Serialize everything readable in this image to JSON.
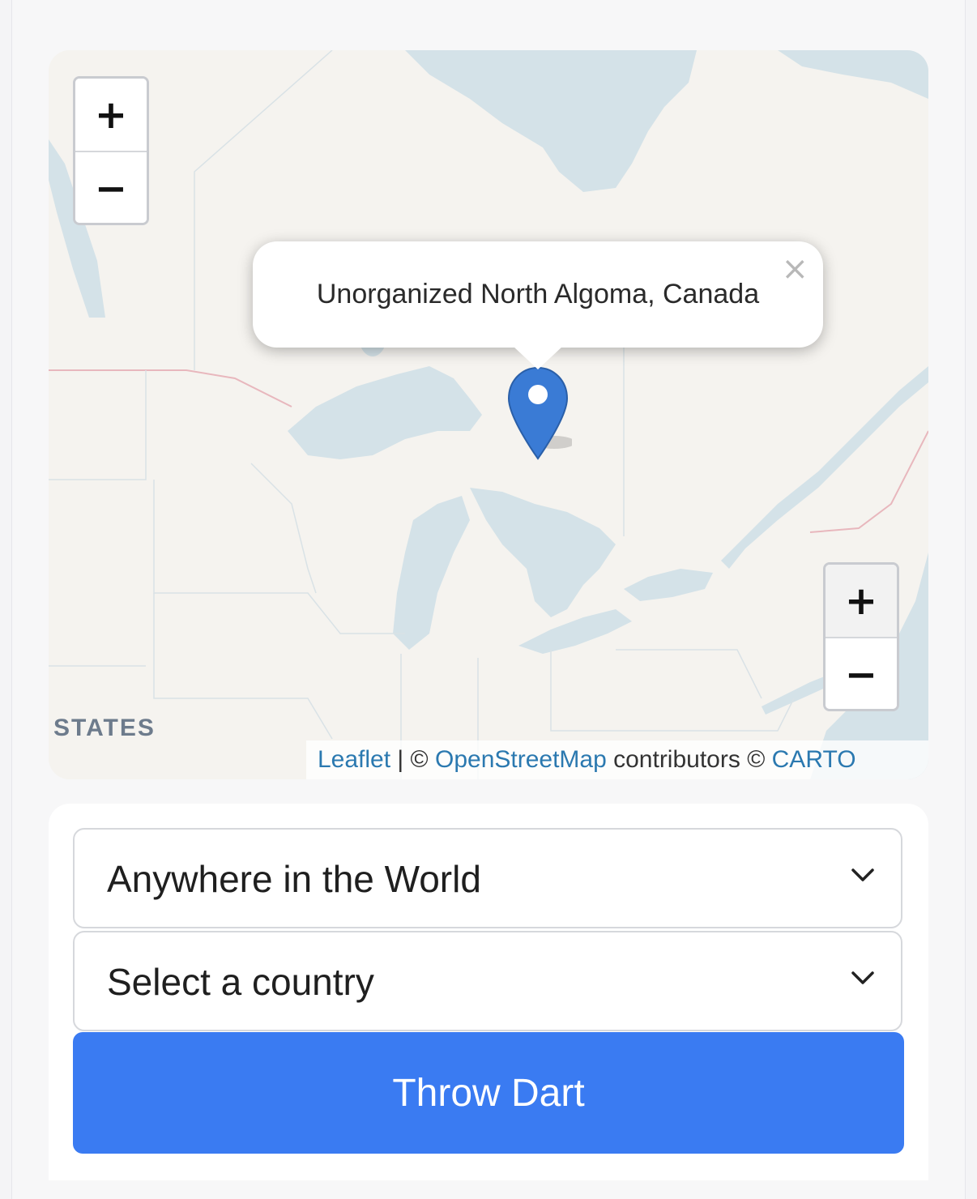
{
  "map": {
    "popup_text": "Unorganized North Algoma, Canada",
    "popup_close": "×",
    "zoom_in": "+",
    "zoom_out": "−",
    "region_label": "STATES",
    "attribution": {
      "leaflet": "Leaflet",
      "sep": " | © ",
      "osm": "OpenStreetMap",
      "contributors": " contributors © ",
      "carto": "CARTO"
    },
    "water_color": "#d4e2e8",
    "land_color": "#f5f3ef",
    "marker_color": "#3a7bd5"
  },
  "controls": {
    "region_select": "Anywhere in the World",
    "country_select": "Select a country",
    "throw_button": "Throw Dart"
  }
}
